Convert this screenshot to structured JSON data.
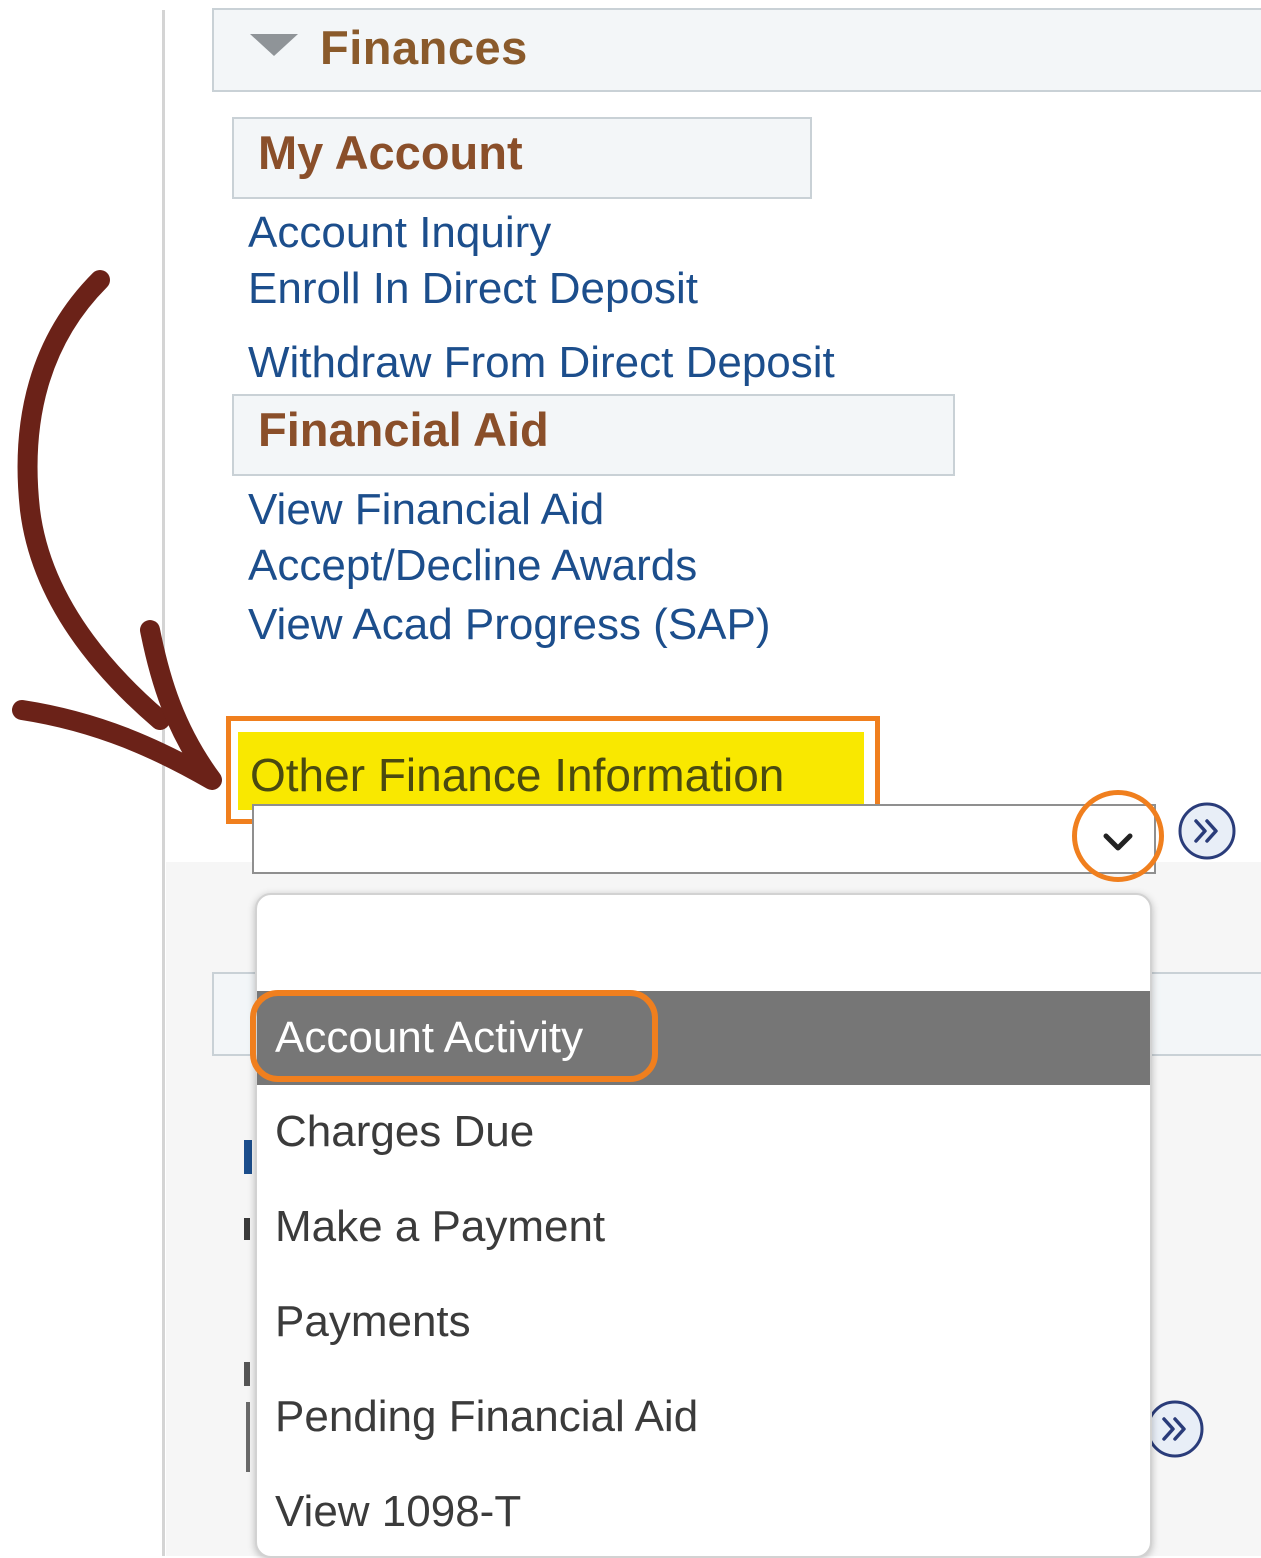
{
  "finances": {
    "title": "Finances"
  },
  "my_account": {
    "title": "My Account",
    "links": [
      "Account Inquiry",
      "Enroll In Direct Deposit",
      "Withdraw From Direct Deposit"
    ]
  },
  "financial_aid": {
    "title": "Financial Aid",
    "links": [
      "View Financial Aid",
      "Accept/Decline Awards",
      "View Acad Progress (SAP)"
    ]
  },
  "other_finance": {
    "label": "Other Finance Information",
    "selected_value": "",
    "options": [
      "",
      "Account Activity",
      "Charges Due",
      "Make a Payment",
      "Payments",
      "Pending Financial Aid",
      "View 1098-T"
    ],
    "highlighted_option": "Account Activity"
  },
  "colors": {
    "section_title": "#8a4f2a",
    "link": "#1c4e8c",
    "highlight_yellow": "#f9e800",
    "annotation_orange": "#f07f1e",
    "arrow_brown": "#6b2218",
    "selected_option_bg": "#767676"
  },
  "icons": {
    "collapse": "triangle-down-icon",
    "dropdown": "chevron-down-icon",
    "go": "double-chevron-right-icon",
    "annotation": "curved-arrow-icon"
  }
}
